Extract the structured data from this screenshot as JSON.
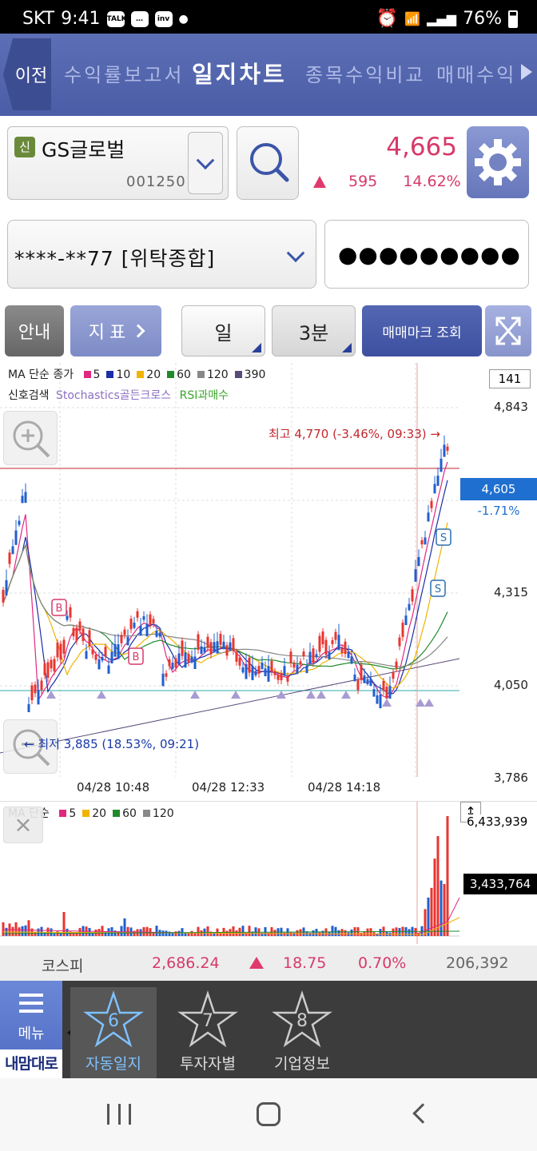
{
  "status": {
    "carrier": "SKT",
    "time": "9:41",
    "battery": "76%"
  },
  "tabs": {
    "back": "이전",
    "items": [
      {
        "label": "수익률보고서"
      },
      {
        "label": "일지차트"
      },
      {
        "label": "종목수익비교"
      },
      {
        "label": "매매수익"
      }
    ]
  },
  "stock": {
    "badge": "신",
    "name": "GS글로벌",
    "code": "001250",
    "price": "4,665",
    "change": "595",
    "change_pct": "14.62%"
  },
  "account": {
    "label": "****-**77 [위탁종합]",
    "password_mask": "●●●●●●●●●"
  },
  "controls": {
    "guide": "안내",
    "indicator": "지표",
    "period": "일",
    "interval": "3분",
    "trade_mark": "매매마크 조회"
  },
  "chart_legend": {
    "ma_title": "MA 단순 종가",
    "ma_items": [
      {
        "label": "5",
        "color": "#e0287f"
      },
      {
        "label": "10",
        "color": "#1a2fa8"
      },
      {
        "label": "20",
        "color": "#f0b400"
      },
      {
        "label": "60",
        "color": "#1f8a2a"
      },
      {
        "label": "120",
        "color": "#888888"
      },
      {
        "label": "390",
        "color": "#5a4a7a"
      }
    ],
    "signal_title": "신호검색",
    "signal_stoch": "Stochastics골든크로스",
    "signal_rsi": "RSI과매수"
  },
  "chart_data": {
    "type": "candlestick",
    "y_ticks": [
      "4,843",
      "4,315",
      "4,050",
      "3,786"
    ],
    "x_ticks": [
      "04/28 10:48",
      "04/28 12:33",
      "04/28 14:18"
    ],
    "period_box": "141",
    "current_price": "4,605",
    "current_pct": "-1.71%",
    "high_label": "최고 4,770 (-3.46%, 09:33) →",
    "low_label": "← 최저 3,885 (18.53%, 09:21)",
    "ylim": [
      3786,
      4843
    ]
  },
  "volume": {
    "title": "MA 단순",
    "ma_items": [
      {
        "label": "5",
        "color": "#e0287f"
      },
      {
        "label": "20",
        "color": "#f0b400"
      },
      {
        "label": "60",
        "color": "#1f8a2a"
      },
      {
        "label": "120",
        "color": "#888888"
      }
    ],
    "max_label": "6,433,939",
    "current_label": "3,433,764"
  },
  "kospi": {
    "name": "코스피",
    "value": "2,686.24",
    "change": "18.75",
    "pct": "0.70%",
    "volume": "206,392"
  },
  "bottom_nav": {
    "menu": "메뉴",
    "brand": "내맘대로",
    "items": [
      {
        "num": "6",
        "label": "자동일지"
      },
      {
        "num": "7",
        "label": "투자자별"
      },
      {
        "num": "8",
        "label": "기업정보"
      }
    ]
  }
}
